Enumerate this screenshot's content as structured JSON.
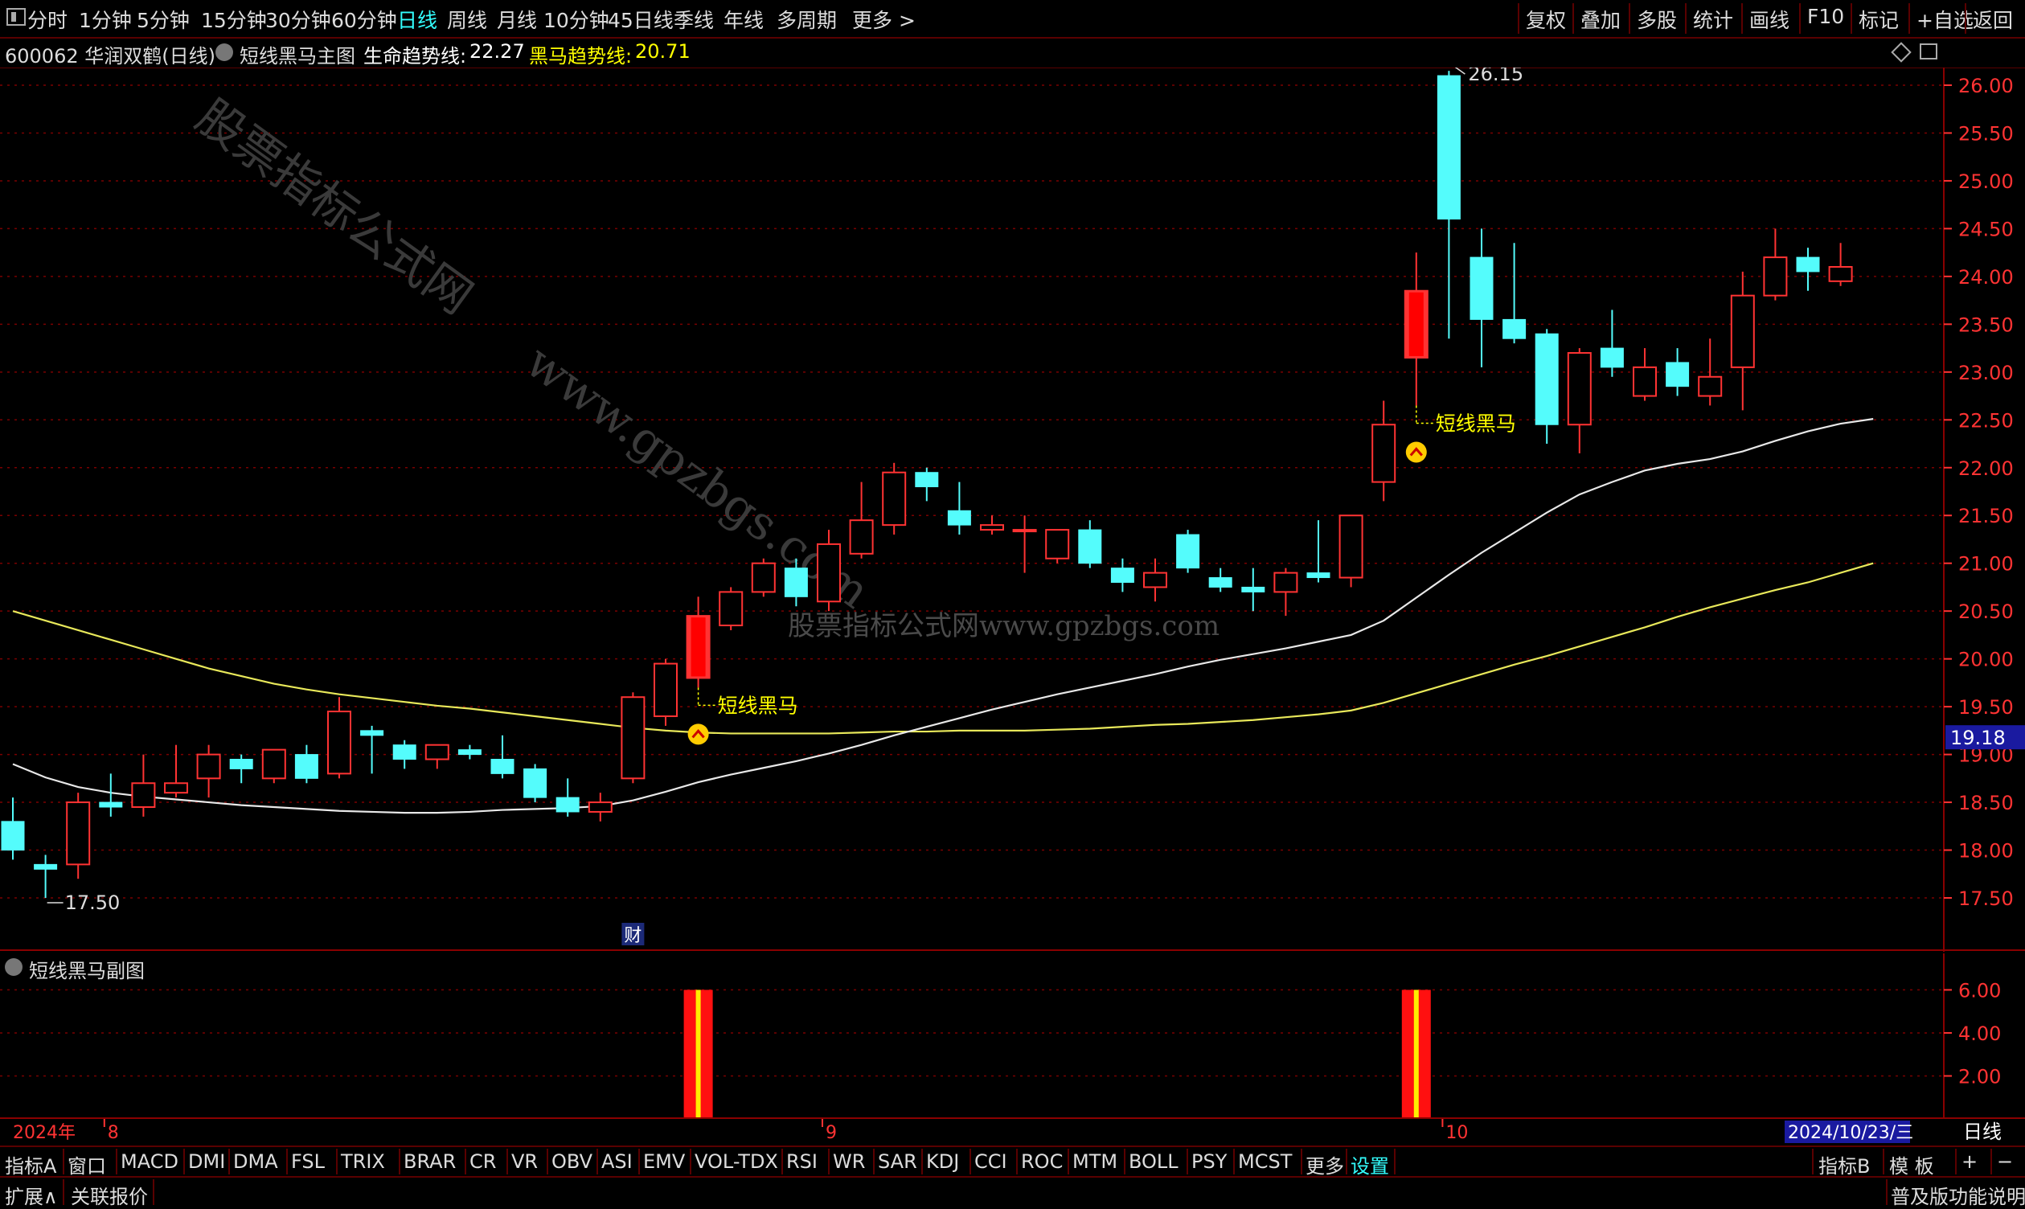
{
  "toolbar": {
    "periods": [
      "分时",
      "1分钟",
      "5分钟",
      "15分钟",
      "30分钟",
      "60分钟",
      "日线",
      "周线",
      "月线",
      "10分钟",
      "45日线",
      "季线",
      "年线",
      "多周期",
      "更多 >"
    ],
    "active_period": "日线",
    "right_buttons": [
      "复权",
      "叠加",
      "多股",
      "统计",
      "画线",
      "F10",
      "标记",
      "+自选",
      "返回"
    ]
  },
  "info": {
    "stock": "600062 华润双鹤(日线)",
    "indicator": "短线黑马主图",
    "life_trend_label": "生命趋势线:",
    "life_trend_value": "22.27",
    "horse_trend_label": "黑马趋势线:",
    "horse_trend_value": "20.71"
  },
  "main_chart": {
    "y_ticks": [
      "26.00",
      "25.50",
      "25.00",
      "24.50",
      "24.00",
      "23.50",
      "23.00",
      "22.50",
      "22.00",
      "21.50",
      "21.00",
      "20.50",
      "20.00",
      "19.50",
      "19.00",
      "18.50",
      "18.00",
      "17.50"
    ],
    "current_price": "19.18",
    "high_label": "26.15",
    "low_label": "17.50",
    "signal_text": "短线黑马",
    "cai_marker": "财",
    "watermark1": "股票指标公式网",
    "watermark2": "www.gpzbgs.com",
    "watermark3": "股票指标公式网www.gpzbgs.com"
  },
  "chart_data": {
    "type": "candlestick",
    "ylim": [
      17.0,
      26.3
    ],
    "candles": [
      {
        "o": 18.3,
        "h": 18.55,
        "l": 17.9,
        "c": 18.0
      },
      {
        "o": 17.85,
        "h": 17.95,
        "l": 17.5,
        "c": 17.8
      },
      {
        "o": 17.85,
        "h": 18.6,
        "l": 17.7,
        "c": 18.5
      },
      {
        "o": 18.5,
        "h": 18.8,
        "l": 18.35,
        "c": 18.45
      },
      {
        "o": 18.45,
        "h": 19.0,
        "l": 18.35,
        "c": 18.7
      },
      {
        "o": 18.6,
        "h": 19.1,
        "l": 18.55,
        "c": 18.7
      },
      {
        "o": 18.75,
        "h": 19.1,
        "l": 18.55,
        "c": 19.0
      },
      {
        "o": 18.95,
        "h": 19.0,
        "l": 18.7,
        "c": 18.85
      },
      {
        "o": 18.75,
        "h": 19.05,
        "l": 18.7,
        "c": 19.05
      },
      {
        "o": 19.0,
        "h": 19.1,
        "l": 18.7,
        "c": 18.75
      },
      {
        "o": 18.8,
        "h": 19.6,
        "l": 18.75,
        "c": 19.45
      },
      {
        "o": 19.25,
        "h": 19.3,
        "l": 18.8,
        "c": 19.2
      },
      {
        "o": 19.1,
        "h": 19.15,
        "l": 18.85,
        "c": 18.95
      },
      {
        "o": 18.95,
        "h": 19.1,
        "l": 18.85,
        "c": 19.1
      },
      {
        "o": 19.05,
        "h": 19.1,
        "l": 18.95,
        "c": 19.0
      },
      {
        "o": 18.95,
        "h": 19.2,
        "l": 18.75,
        "c": 18.8
      },
      {
        "o": 18.85,
        "h": 18.9,
        "l": 18.5,
        "c": 18.55
      },
      {
        "o": 18.55,
        "h": 18.75,
        "l": 18.35,
        "c": 18.4
      },
      {
        "o": 18.4,
        "h": 18.6,
        "l": 18.3,
        "c": 18.5
      },
      {
        "o": 18.75,
        "h": 19.65,
        "l": 18.7,
        "c": 19.6
      },
      {
        "o": 19.4,
        "h": 20.0,
        "l": 19.3,
        "c": 19.95
      },
      {
        "o": 19.8,
        "h": 20.65,
        "l": 19.7,
        "c": 20.45
      },
      {
        "o": 20.35,
        "h": 20.75,
        "l": 20.3,
        "c": 20.7
      },
      {
        "o": 20.7,
        "h": 21.05,
        "l": 20.65,
        "c": 21.0
      },
      {
        "o": 20.95,
        "h": 21.05,
        "l": 20.55,
        "c": 20.65
      },
      {
        "o": 20.6,
        "h": 21.35,
        "l": 20.5,
        "c": 21.2
      },
      {
        "o": 21.1,
        "h": 21.85,
        "l": 21.05,
        "c": 21.45
      },
      {
        "o": 21.4,
        "h": 22.05,
        "l": 21.3,
        "c": 21.95
      },
      {
        "o": 21.95,
        "h": 22.0,
        "l": 21.65,
        "c": 21.8
      },
      {
        "o": 21.55,
        "h": 21.85,
        "l": 21.3,
        "c": 21.4
      },
      {
        "o": 21.35,
        "h": 21.5,
        "l": 21.3,
        "c": 21.4
      },
      {
        "o": 21.35,
        "h": 21.5,
        "l": 20.9,
        "c": 21.35
      },
      {
        "o": 21.05,
        "h": 21.35,
        "l": 21.0,
        "c": 21.35
      },
      {
        "o": 21.35,
        "h": 21.45,
        "l": 20.95,
        "c": 21.0
      },
      {
        "o": 20.95,
        "h": 21.05,
        "l": 20.7,
        "c": 20.8
      },
      {
        "o": 20.75,
        "h": 21.05,
        "l": 20.6,
        "c": 20.9
      },
      {
        "o": 21.3,
        "h": 21.35,
        "l": 20.9,
        "c": 20.95
      },
      {
        "o": 20.85,
        "h": 20.95,
        "l": 20.7,
        "c": 20.75
      },
      {
        "o": 20.75,
        "h": 20.95,
        "l": 20.5,
        "c": 20.7
      },
      {
        "o": 20.7,
        "h": 20.95,
        "l": 20.45,
        "c": 20.9
      },
      {
        "o": 20.9,
        "h": 21.45,
        "l": 20.8,
        "c": 20.85
      },
      {
        "o": 20.85,
        "h": 21.5,
        "l": 20.75,
        "c": 21.5
      },
      {
        "o": 21.85,
        "h": 22.7,
        "l": 21.65,
        "c": 22.45
      },
      {
        "o": 23.15,
        "h": 24.25,
        "l": 22.65,
        "c": 23.85
      },
      {
        "o": 26.1,
        "h": 26.15,
        "l": 23.35,
        "c": 24.6
      },
      {
        "o": 24.2,
        "h": 24.5,
        "l": 23.05,
        "c": 23.55
      },
      {
        "o": 23.55,
        "h": 24.35,
        "l": 23.3,
        "c": 23.35
      },
      {
        "o": 23.4,
        "h": 23.45,
        "l": 22.25,
        "c": 22.45
      },
      {
        "o": 22.45,
        "h": 23.25,
        "l": 22.15,
        "c": 23.2
      },
      {
        "o": 23.25,
        "h": 23.65,
        "l": 22.95,
        "c": 23.05
      },
      {
        "o": 22.75,
        "h": 23.25,
        "l": 22.7,
        "c": 23.05
      },
      {
        "o": 23.1,
        "h": 23.25,
        "l": 22.75,
        "c": 22.85
      },
      {
        "o": 22.75,
        "h": 23.35,
        "l": 22.65,
        "c": 22.95
      },
      {
        "o": 23.05,
        "h": 24.05,
        "l": 22.6,
        "c": 23.8
      },
      {
        "o": 23.8,
        "h": 24.5,
        "l": 23.75,
        "c": 24.2
      },
      {
        "o": 24.2,
        "h": 24.3,
        "l": 23.85,
        "c": 24.05
      },
      {
        "o": 23.95,
        "h": 24.35,
        "l": 23.9,
        "c": 24.1
      }
    ],
    "life_trend_line": [
      18.9,
      18.76,
      18.66,
      18.6,
      18.56,
      18.53,
      18.5,
      18.47,
      18.45,
      18.43,
      18.41,
      18.4,
      18.39,
      18.39,
      18.4,
      18.42,
      18.43,
      18.44,
      18.46,
      18.52,
      18.61,
      18.71,
      18.79,
      18.86,
      18.93,
      19.01,
      19.1,
      19.2,
      19.29,
      19.38,
      19.47,
      19.55,
      19.63,
      19.7,
      19.77,
      19.84,
      19.92,
      19.99,
      20.05,
      20.11,
      20.18,
      20.25,
      20.4,
      20.64,
      20.88,
      21.11,
      21.32,
      21.53,
      21.72,
      21.85,
      21.97,
      22.04,
      22.09,
      22.17,
      22.28,
      22.38,
      22.46,
      22.51
    ],
    "horse_trend_line": [
      20.5,
      20.4,
      20.3,
      20.2,
      20.1,
      20.0,
      19.9,
      19.82,
      19.74,
      19.68,
      19.63,
      19.59,
      19.55,
      19.51,
      19.48,
      19.44,
      19.4,
      19.36,
      19.32,
      19.28,
      19.25,
      19.23,
      19.22,
      19.22,
      19.22,
      19.22,
      19.23,
      19.24,
      19.24,
      19.25,
      19.25,
      19.25,
      19.26,
      19.27,
      19.29,
      19.31,
      19.32,
      19.34,
      19.36,
      19.39,
      19.42,
      19.46,
      19.54,
      19.64,
      19.74,
      19.84,
      19.94,
      20.03,
      20.13,
      20.23,
      20.33,
      20.44,
      20.54,
      20.63,
      20.72,
      20.8,
      20.9,
      21.0
    ],
    "signals": [
      21,
      43
    ],
    "sub_chart": {
      "title": "短线黑马副图",
      "y_ticks": [
        "6.00",
        "4.00",
        "2.00"
      ],
      "ylim": [
        0,
        6.8
      ],
      "bar_value": 6.0,
      "bar_indices": [
        21,
        43
      ]
    },
    "dates": {
      "year": "2024年",
      "month_labels": [
        {
          "i": 3,
          "t": "8"
        },
        {
          "i": 25,
          "t": "9"
        },
        {
          "i": 44,
          "t": "10"
        }
      ],
      "current": "2024/10/23/三",
      "period_box": "日线"
    }
  },
  "bottom_tabs": {
    "items": [
      "指标A",
      "窗口",
      "MACD",
      "DMI",
      "DMA",
      "FSL",
      "TRIX",
      "BRAR",
      "CR",
      "VR",
      "OBV",
      "ASI",
      "EMV",
      "VOL-TDX",
      "RSI",
      "WR",
      "SAR",
      "KDJ",
      "CCI",
      "ROC",
      "MTM",
      "BOLL",
      "PSY",
      "MCST",
      "更多",
      "设置"
    ],
    "right": [
      "指标B",
      "模 板",
      "+",
      "−"
    ]
  },
  "status_bar": {
    "left": [
      "扩展∧",
      "关联报价"
    ],
    "right": "普及版功能说明"
  },
  "colors": {
    "up": "#ff3333",
    "down": "#54fcfc",
    "life_line": "#e8e8e8",
    "horse_line": "#e8e85a",
    "grid": "#7a0000",
    "axis_text": "#ff3333",
    "signal_text": "#ffff00",
    "highlight_tab": "#33ffff"
  }
}
